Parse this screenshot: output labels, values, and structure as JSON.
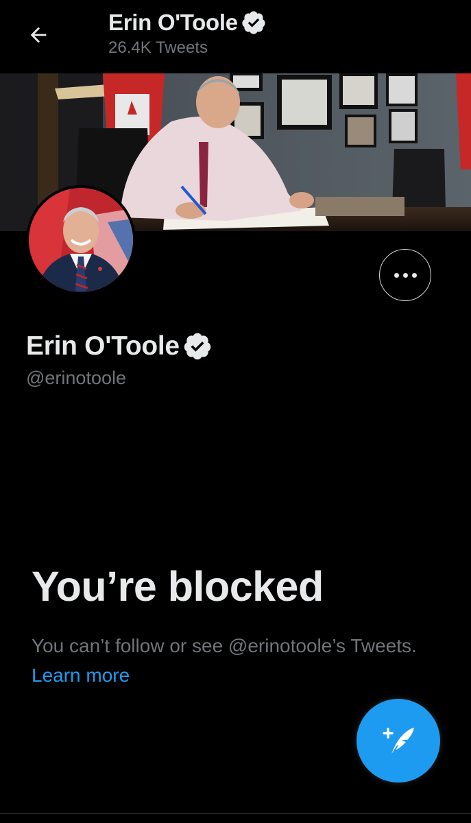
{
  "header": {
    "back_icon": "arrow-left-icon",
    "name": "Erin O'Toole",
    "tweet_count": "26.4K Tweets",
    "verified_icon": "verified-badge-icon"
  },
  "profile": {
    "banner_image": "Erin O'Toole signing documents at desk",
    "avatar_image": "Erin O'Toole portrait",
    "more_icon": "more-horizontal-icon",
    "name": "Erin O'Toole",
    "handle": "@erinotoole"
  },
  "blocked": {
    "title": "You’re blocked",
    "description": "You can’t follow or see @erinotoole’s Tweets.",
    "learn_more": "Learn more"
  },
  "compose": {
    "icon": "compose-tweet-icon"
  },
  "colors": {
    "background": "#000000",
    "primary_text": "#e7e9ea",
    "secondary_text": "#71767b",
    "accent": "#1d9bf0"
  }
}
